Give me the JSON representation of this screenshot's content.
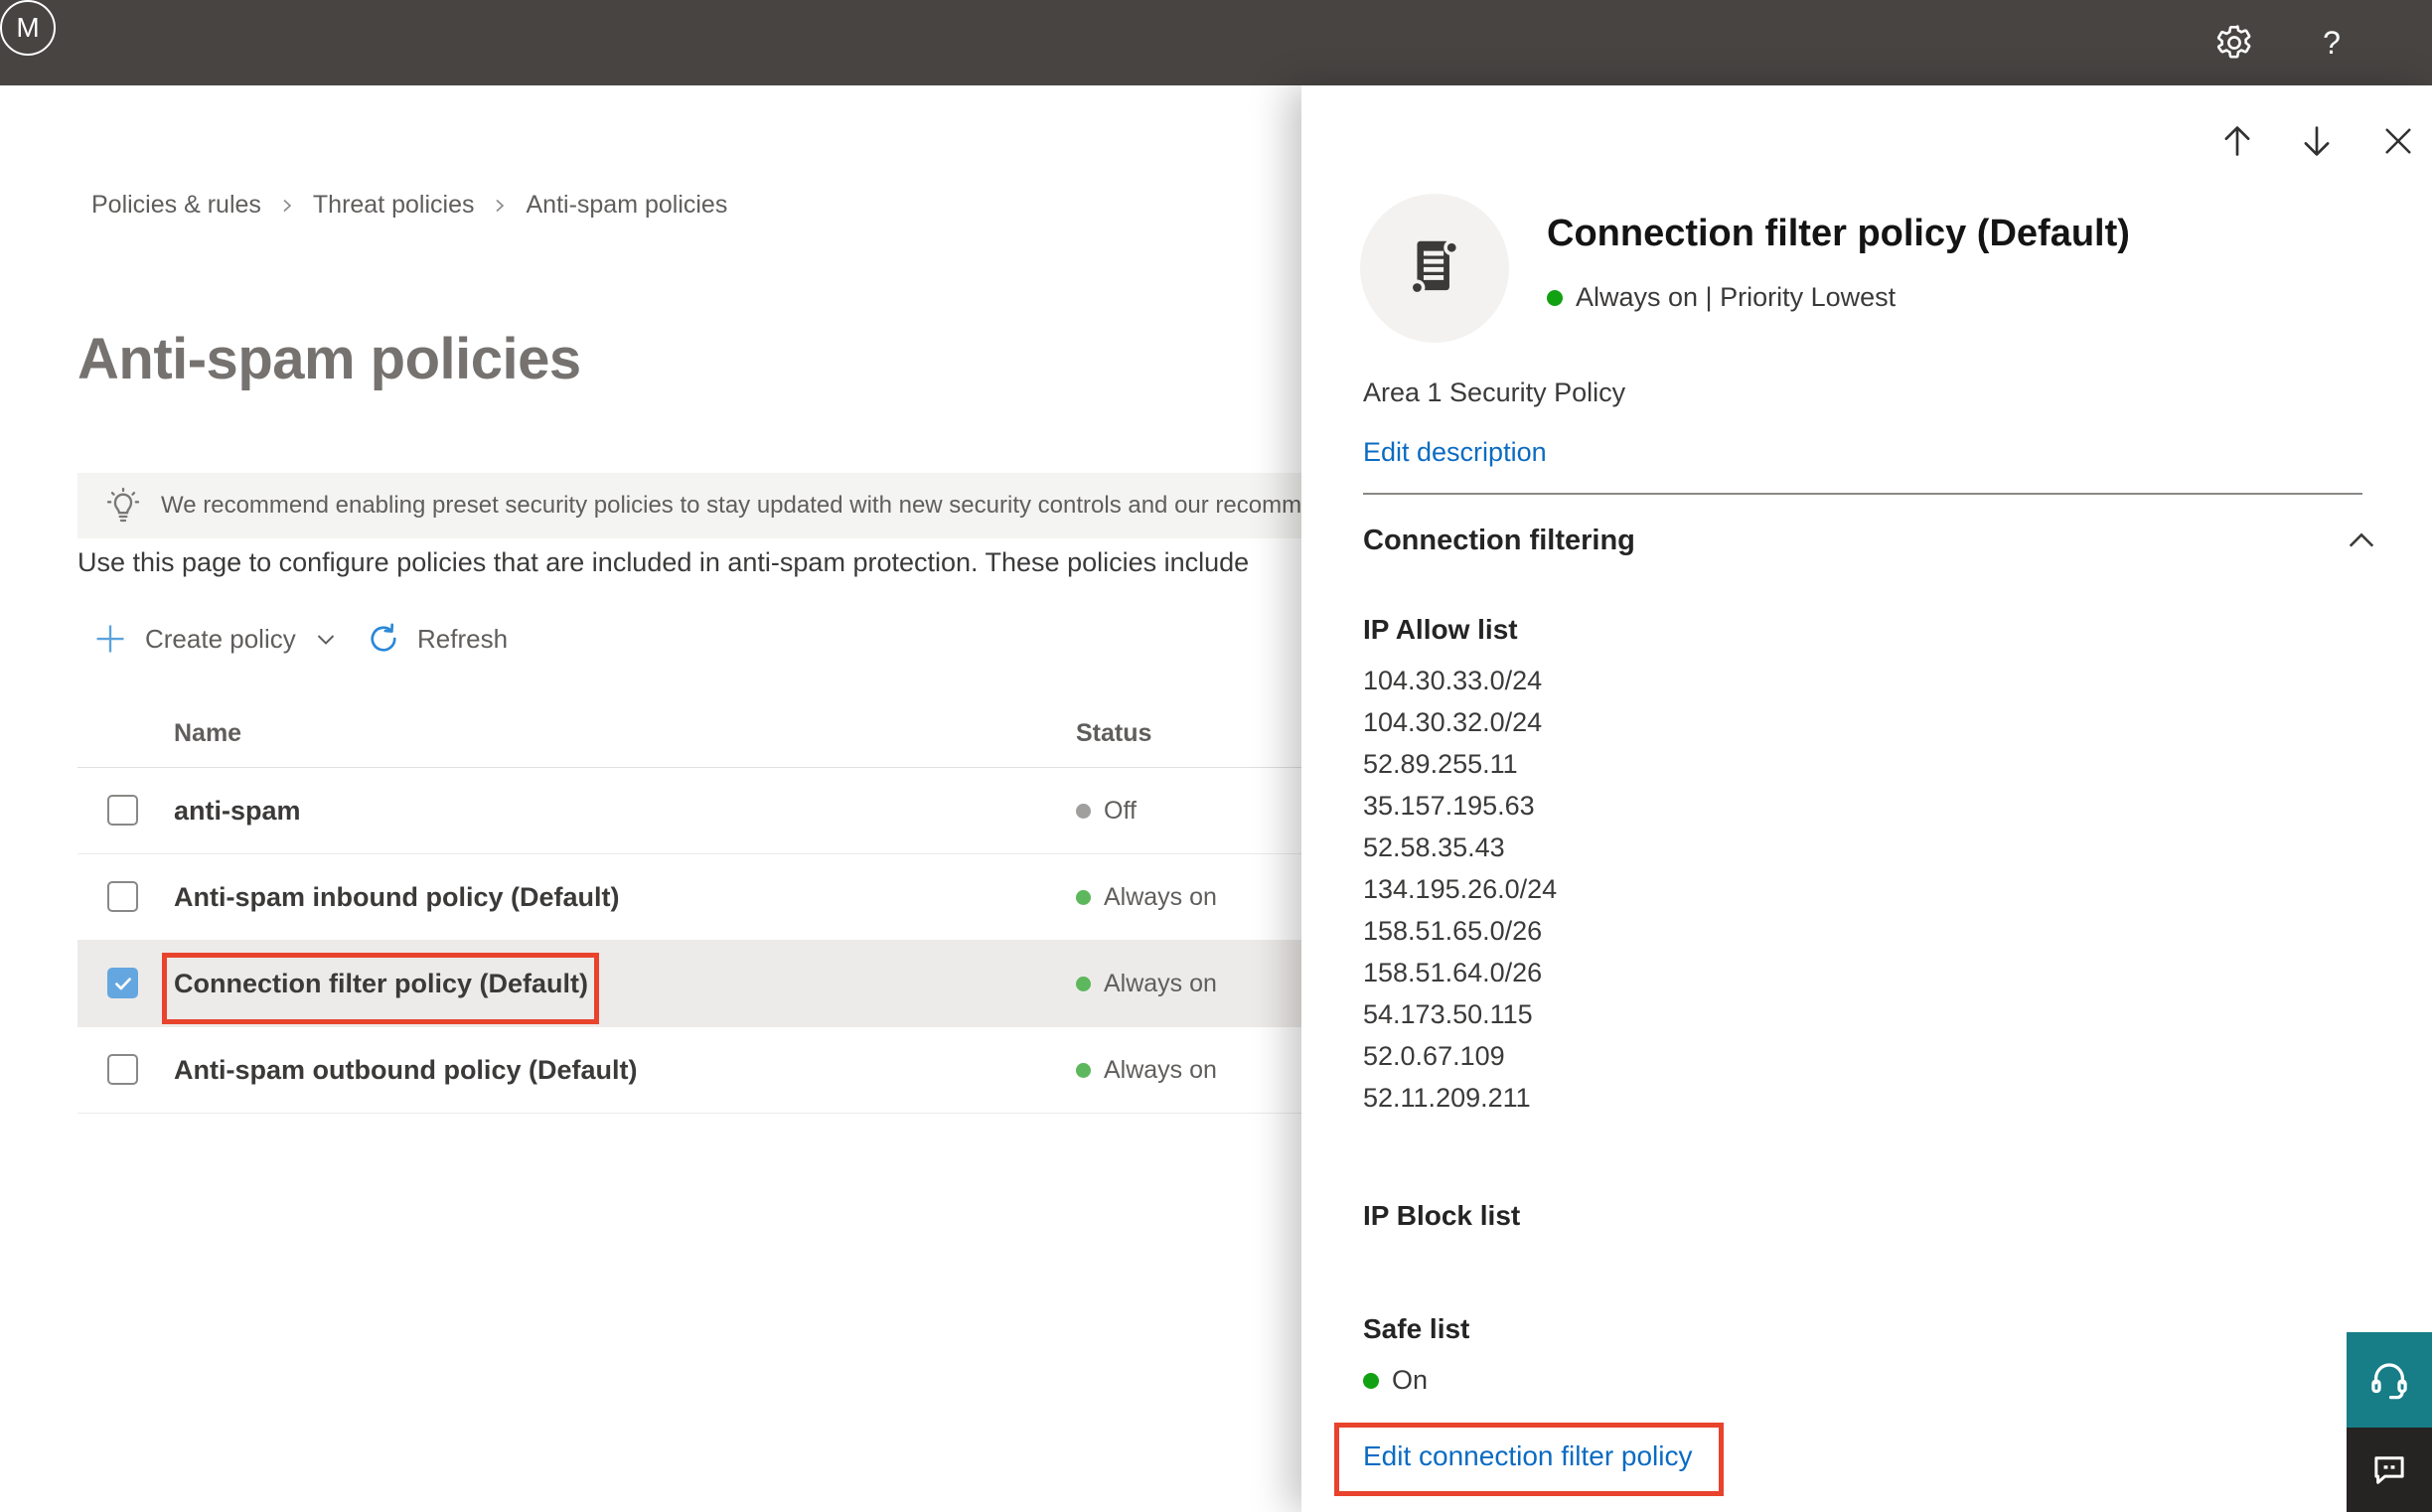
{
  "topbar": {
    "help_label": "?",
    "avatar_initial": "M"
  },
  "breadcrumb": {
    "items": [
      "Policies & rules",
      "Threat policies",
      "Anti-spam policies"
    ]
  },
  "main": {
    "title": "Anti-spam policies",
    "banner": {
      "text": "We recommend enabling preset security policies to stay updated with new security controls and our recomme"
    },
    "intro": "Use this page to configure policies that are included in anti-spam protection. These policies include",
    "toolbar": {
      "create_policy": "Create policy",
      "refresh": "Refresh"
    },
    "table": {
      "headers": {
        "name": "Name",
        "status": "Status"
      },
      "rows": [
        {
          "name": "anti-spam",
          "status": "Off"
        },
        {
          "name": "Anti-spam inbound policy (Default)",
          "status": "Always on"
        },
        {
          "name": "Connection filter policy (Default)",
          "status": "Always on"
        },
        {
          "name": "Anti-spam outbound policy (Default)",
          "status": "Always on"
        }
      ]
    }
  },
  "flyout": {
    "title": "Connection filter policy (Default)",
    "status_line": "Always on | Priority Lowest",
    "description": "Area 1 Security Policy",
    "edit_description": "Edit description",
    "section": "Connection filtering",
    "ip_allow_title": "IP Allow list",
    "ip_allow": [
      "104.30.33.0/24",
      "104.30.32.0/24",
      "52.89.255.11",
      "35.157.195.63",
      "52.58.35.43",
      "134.195.26.0/24",
      "158.51.65.0/26",
      "158.51.64.0/26",
      "54.173.50.115",
      "52.0.67.109",
      "52.11.209.211"
    ],
    "ip_block_title": "IP Block list",
    "safe_list_title": "Safe list",
    "safe_list_status": "On",
    "edit_link": "Edit connection filter policy"
  },
  "colors": {
    "topbar_bg": "#474442",
    "accent_blue": "#0b6bc2",
    "annotation_red": "#e8432d",
    "status_green_bright": "#12a112",
    "status_green_soft": "#5db75d",
    "status_gray": "#a19f9d",
    "selected_row_bg": "#edebe9",
    "checkbox_checked": "#64a7e0",
    "support_teal": "#177d87",
    "feedback_dark": "#252423"
  }
}
